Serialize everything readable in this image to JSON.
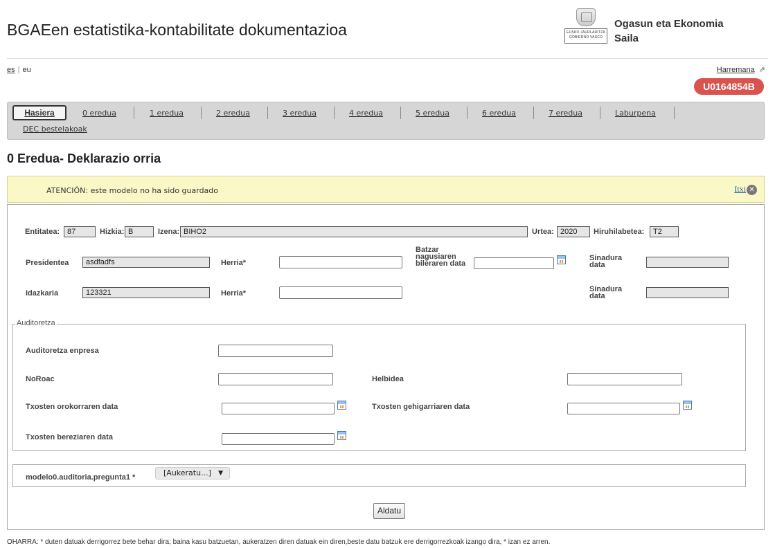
{
  "header": {
    "title": "BGAEen estatistika-kontabilitate dokumentazioa",
    "logo_text_1": "EUSKO JAURLARITZA",
    "logo_text_2": "GOBIERNO VASCO",
    "department_line1": "Ogasun eta Ekonomia",
    "department_line2": "Saila"
  },
  "languages": {
    "es": "es",
    "separator": "|",
    "eu": "eu"
  },
  "contact": {
    "label": "Harremana",
    "icon": "external-link-icon"
  },
  "user": {
    "id": "U0164854B"
  },
  "nav": {
    "active": "Hasiera",
    "items": [
      "0 eredua",
      "1 eredua",
      "2 eredua",
      "3 eredua",
      "4 eredua",
      "5 eredua",
      "6 eredua",
      "7 eredua",
      "Laburpena"
    ],
    "second_row": "DEC bestelakoak"
  },
  "page_title": "0 Eredua- Deklarazio orria",
  "alert": {
    "message": "ATENCIÓN: este modelo no ha sido guardado",
    "close_label": "Itxi",
    "close_icon": "close-icon"
  },
  "form": {
    "entitatea": {
      "label": "Entitatea:",
      "value": "87"
    },
    "hizkia": {
      "label": "Hizkia:",
      "value": "B"
    },
    "izena": {
      "label": "Izena:",
      "value": "BIHO2"
    },
    "urtea": {
      "label": "Urtea:",
      "value": "2020"
    },
    "hiruhilabetea": {
      "label": "Hiruhilabetea:",
      "value": "T2"
    },
    "presidentea": {
      "label": "Presidentea",
      "value": "asdfadfs"
    },
    "herria_1": {
      "label": "Herria*",
      "value": ""
    },
    "batzar": {
      "label": "Batzar nagusiaren bileraren data",
      "value": ""
    },
    "sinadura_1": {
      "label": "Sinadura data",
      "value": ""
    },
    "idazkaria": {
      "label": "Idazkaria",
      "value": "123321"
    },
    "herria_2": {
      "label": "Herria*",
      "value": ""
    },
    "sinadura_2": {
      "label": "Sinadura data",
      "value": ""
    }
  },
  "auditoretza": {
    "legend": "Auditoretza",
    "enpresa_label": "Auditoretza enpresa",
    "noroac_label": "NoRoac",
    "helbidea_label": "Helbidea",
    "orokorra_label": "Txosten orokorraren data",
    "gehigarria_label": "Txosten gehigarriaren data",
    "berezia_label": "Txosten bereziaren data"
  },
  "question": {
    "label": "modelo0.auditoria.pregunta1 *",
    "selected": "[Aukeratu...]"
  },
  "submit_label": "Aldatu",
  "footnote": "OHARRA: * duten datuak derrigorrez bete behar dira; baina kasu batzuetan, aukeratzen diren datuak ein diren,beste datu batzuk ere derrigorrezkoak izango dira, * izan ez arren.",
  "colors": {
    "badge": "#d9534f",
    "alert_bg": "#fbf8c8",
    "nav_bg": "#d6d6d6",
    "link": "#1a5ea8"
  }
}
